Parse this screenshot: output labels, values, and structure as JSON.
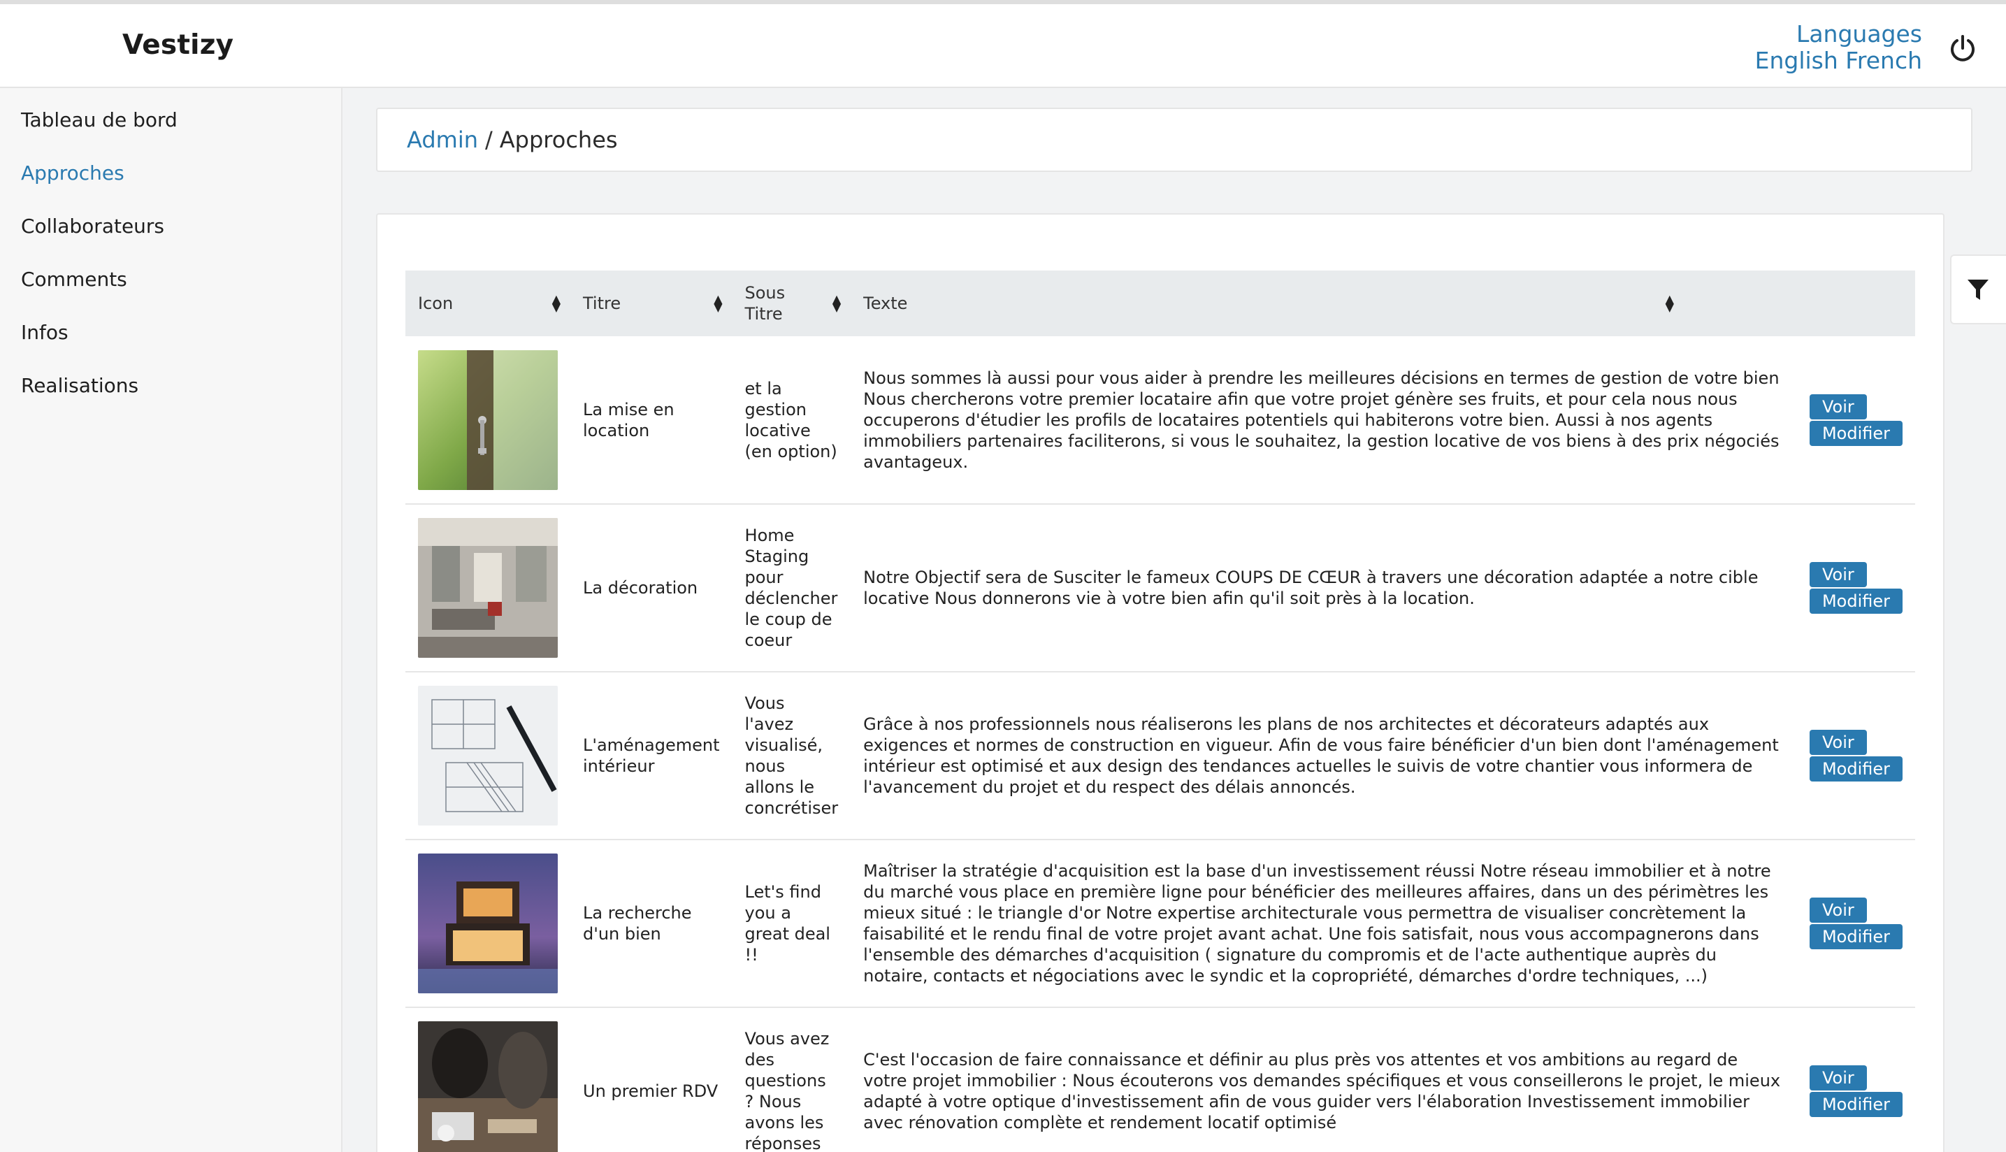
{
  "header": {
    "brand": "Vestizy",
    "languages_label": "Languages",
    "languages": [
      "English",
      "French"
    ]
  },
  "sidebar": {
    "items": [
      {
        "label": "Tableau de bord",
        "active": false
      },
      {
        "label": "Approches",
        "active": true
      },
      {
        "label": "Collaborateurs",
        "active": false
      },
      {
        "label": "Comments",
        "active": false
      },
      {
        "label": "Infos",
        "active": false
      },
      {
        "label": "Realisations",
        "active": false
      }
    ]
  },
  "breadcrumb": {
    "root": "Admin",
    "separator": "/",
    "current": "Approches"
  },
  "table": {
    "columns": [
      "Icon",
      "Titre",
      "Sous Titre",
      "Texte"
    ],
    "view_label": "Voir",
    "edit_label": "Modifier",
    "rows": [
      {
        "icon": "key-in-door-photo",
        "titre": "La mise en location",
        "sous_titre": "et la gestion locative (en option)",
        "texte": "Nous sommes là aussi pour vous aider à prendre les meilleures décisions en termes de gestion de votre bien Nous chercherons votre premier locataire afin que votre projet génère ses fruits, et pour cela nous nous occuperons d'étudier les profils de locataires potentiels qui habiterons votre bien. Aussi à nos agents immobiliers partenaires faciliterons, si vous le souhaitez, la gestion locative de vos biens à des prix négociés avantageux."
      },
      {
        "icon": "living-room-photo",
        "titre": "La décoration",
        "sous_titre": "Home Staging pour déclencher le coup de coeur",
        "texte": "Notre Objectif sera de Susciter le fameux COUPS DE CŒUR à travers une décoration adaptée a notre cible locative Nous donnerons vie à votre bien afin qu'il soit près à la location."
      },
      {
        "icon": "blueprint-photo",
        "titre": "L'aménagement intérieur",
        "sous_titre": "Vous l'avez visualisé, nous allons le concrétiser",
        "texte": "Grâce à nos professionnels nous réaliserons les plans de nos architectes et décorateurs adaptés aux exigences et normes de construction en vigueur. Afin de vous faire bénéficier d'un bien dont l'aménagement intérieur est optimisé et aux design des tendances actuelles le suivis de votre chantier vous informera de l'avancement du projet et du respect des délais annoncés."
      },
      {
        "icon": "modern-house-photo",
        "titre": "La recherche d'un bien",
        "sous_titre": "Let's find you a great deal !!",
        "texte": "Maîtriser la stratégie d'acquisition est la base d'un investissement réussi Notre réseau immobilier et à notre du marché vous place en première ligne pour bénéficier des meilleures affaires, dans un des périmètres les mieux situé : le triangle d'or Notre expertise architecturale vous permettra de visualiser concrètement la faisabilité et le rendu final de votre projet avant achat. Une fois satisfait, nous vous accompagnerons dans l'ensemble des démarches d'acquisition ( signature du compromis et de l'acte authentique auprès du notaire, contacts et négociations avec le syndic et la copropriété, démarches d'ordre techniques, ...)"
      },
      {
        "icon": "meeting-photo",
        "titre": "Un premier RDV",
        "sous_titre": "Vous avez des questions ? Nous avons les réponses",
        "texte": "C'est l'occasion de faire connaissance et définir au plus près vos attentes et vos ambitions au regard de votre projet immobilier : Nous écouterons vos demandes spécifiques et vous conseillerons le projet, le mieux adapté à votre optique d'investissement afin de vous guider vers l'élaboration Investissement immobilier avec rénovation complète et rendement locatif optimisé"
      }
    ]
  },
  "colors": {
    "accent": "#2a7ab0",
    "header_bg": "#e8ebed",
    "page_bg": "#f2f3f4"
  }
}
